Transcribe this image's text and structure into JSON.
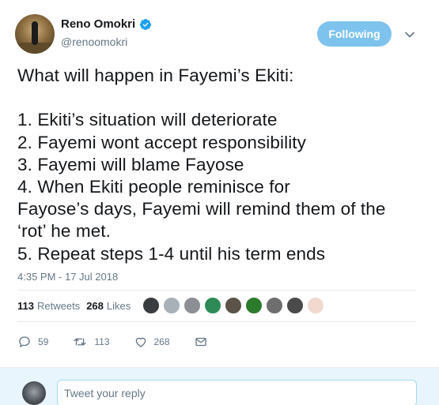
{
  "user": {
    "display_name": "Reno Omokri",
    "handle": "@renoomokri",
    "verified": true
  },
  "follow_button": {
    "label": "Following"
  },
  "tweet": {
    "text": "What will happen in Fayemi’s Ekiti:\n\n1. Ekiti’s situation will deteriorate\n2. Fayemi wont accept responsibility\n3. Fayemi will blame Fayose\n4. When Ekiti people reminisce for\nFayose’s days, Fayemi will remind them of the\n‘rot’ he met.\n5. Repeat steps 1-4 until his term ends",
    "timestamp": "4:35 PM - 17 Jul 2018"
  },
  "stats": {
    "retweets_count": "113",
    "retweets_label": "Retweets",
    "likes_count": "268",
    "likes_label": "Likes"
  },
  "likers": [
    "#3a3d40",
    "#a9b1b8",
    "#8b8f93",
    "#2e8b57",
    "#5b5347",
    "#2c7a2c",
    "#6e6e6e",
    "#4a4a4a",
    "#f1d9d0"
  ],
  "actions": {
    "reply_count": "59",
    "retweet_count": "113",
    "like_count": "268"
  },
  "reply": {
    "placeholder": "Tweet your reply"
  },
  "colors": {
    "accent": "#1da1f2",
    "follow_bg": "#7ec3ee",
    "muted": "#657786",
    "reply_bar_bg": "#e8f5fd"
  },
  "icons": [
    "verified-badge-icon",
    "chevron-down-icon",
    "reply-icon",
    "retweet-icon",
    "heart-icon",
    "direct-message-icon"
  ]
}
